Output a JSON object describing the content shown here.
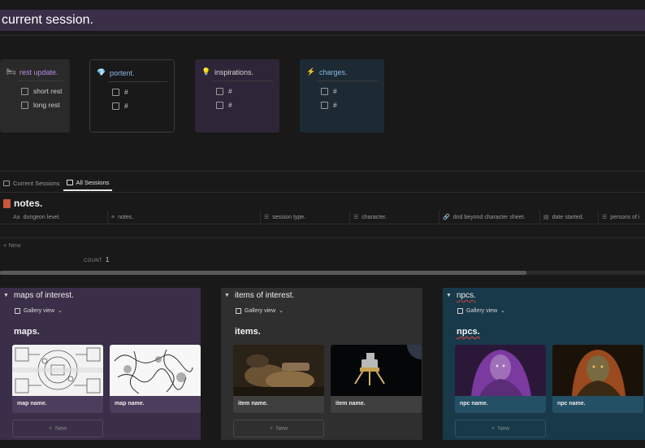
{
  "page": {
    "title": "current session."
  },
  "callouts": [
    {
      "icon": "bed-icon",
      "glyph": "🛏",
      "label": "rest update.",
      "color": "#b48ce0",
      "items": [
        "short rest",
        "long rest"
      ]
    },
    {
      "icon": "gem-icon",
      "glyph": "💎",
      "label": "portent.",
      "color": "#8fb8e8",
      "items": [
        "#",
        "#"
      ]
    },
    {
      "icon": "lightbulb-icon",
      "glyph": "💡",
      "label": "inspirations.",
      "color": "#d6d6d6",
      "items": [
        "#",
        "#"
      ]
    },
    {
      "icon": "lightning-icon",
      "glyph": "⚡",
      "label": "charges.",
      "color": "#8ab8e8",
      "items": [
        "#",
        "#"
      ]
    }
  ],
  "tabs": [
    {
      "label": "Current Sessions",
      "active": false
    },
    {
      "label": "All Sessions",
      "active": true
    }
  ],
  "notes": {
    "title": "notes.",
    "columns": [
      {
        "icon": "Aa",
        "label": "dungeon level."
      },
      {
        "icon": "≡",
        "label": "notes."
      },
      {
        "icon": "☰",
        "label": "session type."
      },
      {
        "icon": "☰",
        "label": "character."
      },
      {
        "icon": "🔗",
        "label": "dnd beyond character sheet."
      },
      {
        "icon": "▤",
        "label": "date started."
      },
      {
        "icon": "☰",
        "label": "persons of i"
      }
    ],
    "new_label": "New",
    "count_label": "COUNT",
    "count_value": "1"
  },
  "galleries": [
    {
      "title": "maps of interest.",
      "view": "Gallery view",
      "heading": "maps.",
      "cards": [
        "map name.",
        "map name."
      ],
      "new_label": "New"
    },
    {
      "title": "items of interest.",
      "view": "Gallery view",
      "heading": "items.",
      "cards": [
        "item name.",
        "item name."
      ],
      "new_label": "New"
    },
    {
      "title": "npcs.",
      "view": "Gallery view",
      "heading": "npcs.",
      "cards": [
        "npc name.",
        "npc name."
      ],
      "new_label": "New"
    }
  ]
}
